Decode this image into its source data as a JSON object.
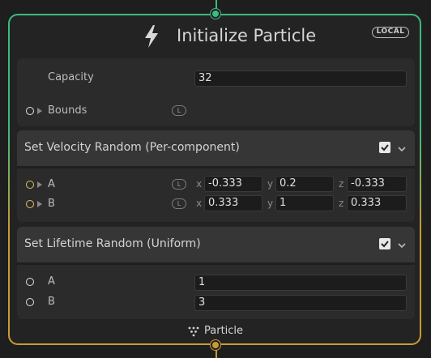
{
  "node": {
    "title": "Initialize Particle",
    "space_badge": "LOCAL",
    "footer_label": "Particle",
    "colors": {
      "top_accent": "#3dba80",
      "bottom_accent": "#c99b33"
    }
  },
  "init": {
    "capacity_label": "Capacity",
    "capacity_value": "32",
    "bounds_label": "Bounds",
    "bounds_badge": "L"
  },
  "velocity_block": {
    "title": "Set Velocity Random (Per-component)",
    "enabled": true,
    "rows": [
      {
        "label": "A",
        "badge": "L",
        "x_label": "x",
        "x": "-0.333",
        "y_label": "y",
        "y": "0.2",
        "z_label": "z",
        "z": "-0.333"
      },
      {
        "label": "B",
        "badge": "L",
        "x_label": "x",
        "x": "0.333",
        "y_label": "y",
        "y": "1",
        "z_label": "z",
        "z": "0.333"
      }
    ]
  },
  "lifetime_block": {
    "title": "Set Lifetime Random (Uniform)",
    "enabled": true,
    "rows": [
      {
        "label": "A",
        "value": "1"
      },
      {
        "label": "B",
        "value": "3"
      }
    ]
  }
}
